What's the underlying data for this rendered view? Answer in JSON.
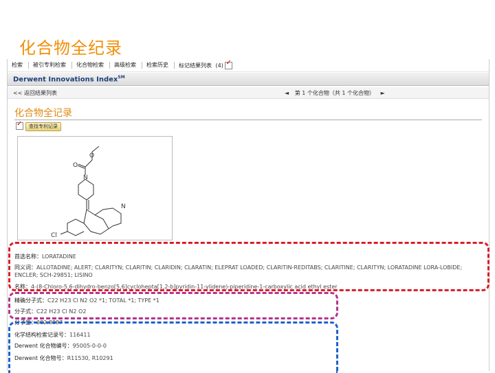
{
  "slide": {
    "title": "化合物全纪录"
  },
  "topnav": {
    "items": [
      "检索",
      "被引专利检索",
      "化合物检索",
      "高级检索",
      "检索历史",
      "标记结果列表",
      "(4)"
    ]
  },
  "app": {
    "title": "Derwent Innovations Index",
    "title_sup": "SM"
  },
  "navrow": {
    "back": "<< 返回结果列表",
    "pager_prev": "◄",
    "pager_text": "第 1 个化合物（共 1 个化合物）",
    "pager_next": "►"
  },
  "record": {
    "title": "化合物全记录",
    "patent_button": "查找专利记录",
    "structure_atoms": {
      "o1": "O",
      "n1": "N",
      "n2": "N",
      "cl": "Cl"
    }
  },
  "fields": [
    {
      "label": "首选名称：",
      "value": "LORATADINE"
    },
    {
      "label": "同义词：",
      "value": "ALLOTADINE; ALERT; CLARITYN; CLARITIN; CLARIDIN; CLARATIN; ELEPRAT LOADED; CLARITIN-REDITABS; CLARITINE; CLARITYN; LORATADINE LORA-LOBIDE; ENCLER; SCH-29851; LISINO"
    },
    {
      "label": "名称：",
      "value": "4-(8-Chloro-5,6-dihydro-benzo[5,6]cyclohepta[1,2-b]pyridin-11-ylidene)-piperidine-1-carboxylic acid ethyl ester"
    },
    {
      "label": "精确分子式：",
      "value": "C22 H23 Cl N2 O2 *1; TOTAL *1; TYPE *1"
    },
    {
      "label": "分子式：",
      "value": "C22 H23 Cl N2 O2"
    },
    {
      "label": "分子量：",
      "value": "382.8887"
    },
    {
      "label": "化学结构检索记录号：",
      "value": "116411"
    },
    {
      "label": "Derwent 化合物编号：",
      "value": "95005-0-0-0"
    },
    {
      "label": "Derwent 化合物号：",
      "value": "R11530, R10291"
    }
  ],
  "highlight_colors": {
    "red": "#d81e2a",
    "magenta": "#b5338a",
    "blue": "#1e63c8"
  }
}
